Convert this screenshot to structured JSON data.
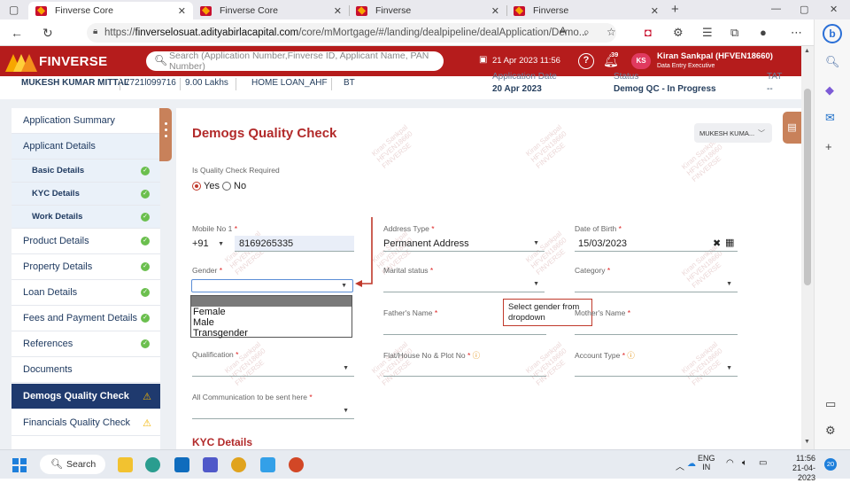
{
  "browser": {
    "tabs": [
      {
        "title": "Finverse Core",
        "active": true
      },
      {
        "title": "Finverse Core",
        "active": false
      },
      {
        "title": "Finverse",
        "active": false
      },
      {
        "title": "Finverse",
        "active": false
      },
      {
        "title": "Finverse",
        "active": false
      }
    ],
    "url_prefix": "https://",
    "url_host": "finverselosuat.adityabirlacapital.com",
    "url_path": "/core/mMortgage/#/landing/dealpipeline/dealApplication/Demo...",
    "window_controls": [
      "—",
      "▢",
      "✕"
    ]
  },
  "header": {
    "brand": "FINVERSE",
    "search_placeholder": "Search (Application Number,Finverse ID, Applicant Name, PAN Number)",
    "datetime": "21 Apr 2023 11:56",
    "notification_count": "39",
    "avatar_initials": "KS",
    "user_name": "Kiran Sankpal (HFVEN18660)",
    "user_role": "Data Entry Executive"
  },
  "info_strip": {
    "applicant": "MUKESH KUMAR MITTAL",
    "phone": "7721l099716",
    "amount": "9.00 Lakhs",
    "product": "HOME LOAN_AHF",
    "code": "BT",
    "app_date_label": "Application Date",
    "app_date": "20 Apr 2023",
    "status_label": "Status",
    "status": "Demog QC - In Progress",
    "tat_label": "TAT",
    "tat": "--"
  },
  "sidebar": {
    "items": [
      {
        "label": "Application Summary",
        "type": "main",
        "status": "none"
      },
      {
        "label": "Applicant Details",
        "type": "main",
        "status": "none",
        "highlight": true
      },
      {
        "label": "Basic Details",
        "type": "sub",
        "status": "ok"
      },
      {
        "label": "KYC Details",
        "type": "sub",
        "status": "ok"
      },
      {
        "label": "Work Details",
        "type": "sub",
        "status": "ok"
      },
      {
        "label": "Product Details",
        "type": "main",
        "status": "ok"
      },
      {
        "label": "Property Details",
        "type": "main",
        "status": "ok"
      },
      {
        "label": "Loan Details",
        "type": "main",
        "status": "ok"
      },
      {
        "label": "Fees and Payment Details",
        "type": "main",
        "status": "ok"
      },
      {
        "label": "References",
        "type": "main",
        "status": "ok"
      },
      {
        "label": "Documents",
        "type": "main",
        "status": "none"
      },
      {
        "label": "Demogs Quality Check",
        "type": "main",
        "status": "warn",
        "active": true
      },
      {
        "label": "Financials Quality Check",
        "type": "main",
        "status": "warn"
      }
    ]
  },
  "main": {
    "title": "Demogs Quality Check",
    "applicant_dropdown": "MUKESH KUMA...",
    "qc_required_label": "Is Quality Check Required",
    "qc_yes": "Yes",
    "qc_no": "No",
    "qc_selected": "Yes",
    "fields": {
      "mobile_label": "Mobile No 1",
      "mobile_code": "+91",
      "mobile_value": "8169265335",
      "address_type_label": "Address Type",
      "address_type_value": "Permanent Address",
      "dob_label": "Date of Birth",
      "dob_value": "15/03/2023",
      "gender_label": "Gender",
      "gender_value": "",
      "marital_label": "Marital status",
      "category_label": "Category",
      "father_label": "Father's Name",
      "mother_label": "Mother's Name",
      "qualification_label": "Qualification",
      "flat_label": "Flat/House No & Plot No",
      "account_type_label": "Account Type",
      "communication_label": "All Communication to be sent here",
      "required_mark": "*"
    },
    "gender_options": [
      "",
      "Female",
      "Male",
      "Transgender"
    ],
    "callout": "Select gender from dropdown",
    "kyc_heading": "KYC Details",
    "watermark_name": "Kiran Sankpal",
    "watermark_id": "HFVEN18660",
    "watermark_brand": "FINVERSE"
  },
  "taskbar": {
    "search_label": "Search",
    "lang_top": "ENG",
    "lang_bottom": "IN",
    "time": "11:56",
    "date": "21-04-2023",
    "notification_count": "20"
  },
  "colors": {
    "brand_red": "#b51c1c",
    "title_red": "#b22a2a",
    "nav_active": "#1f3a6e",
    "ok_green": "#6bbf4e",
    "warn_yellow": "#f2b400"
  }
}
